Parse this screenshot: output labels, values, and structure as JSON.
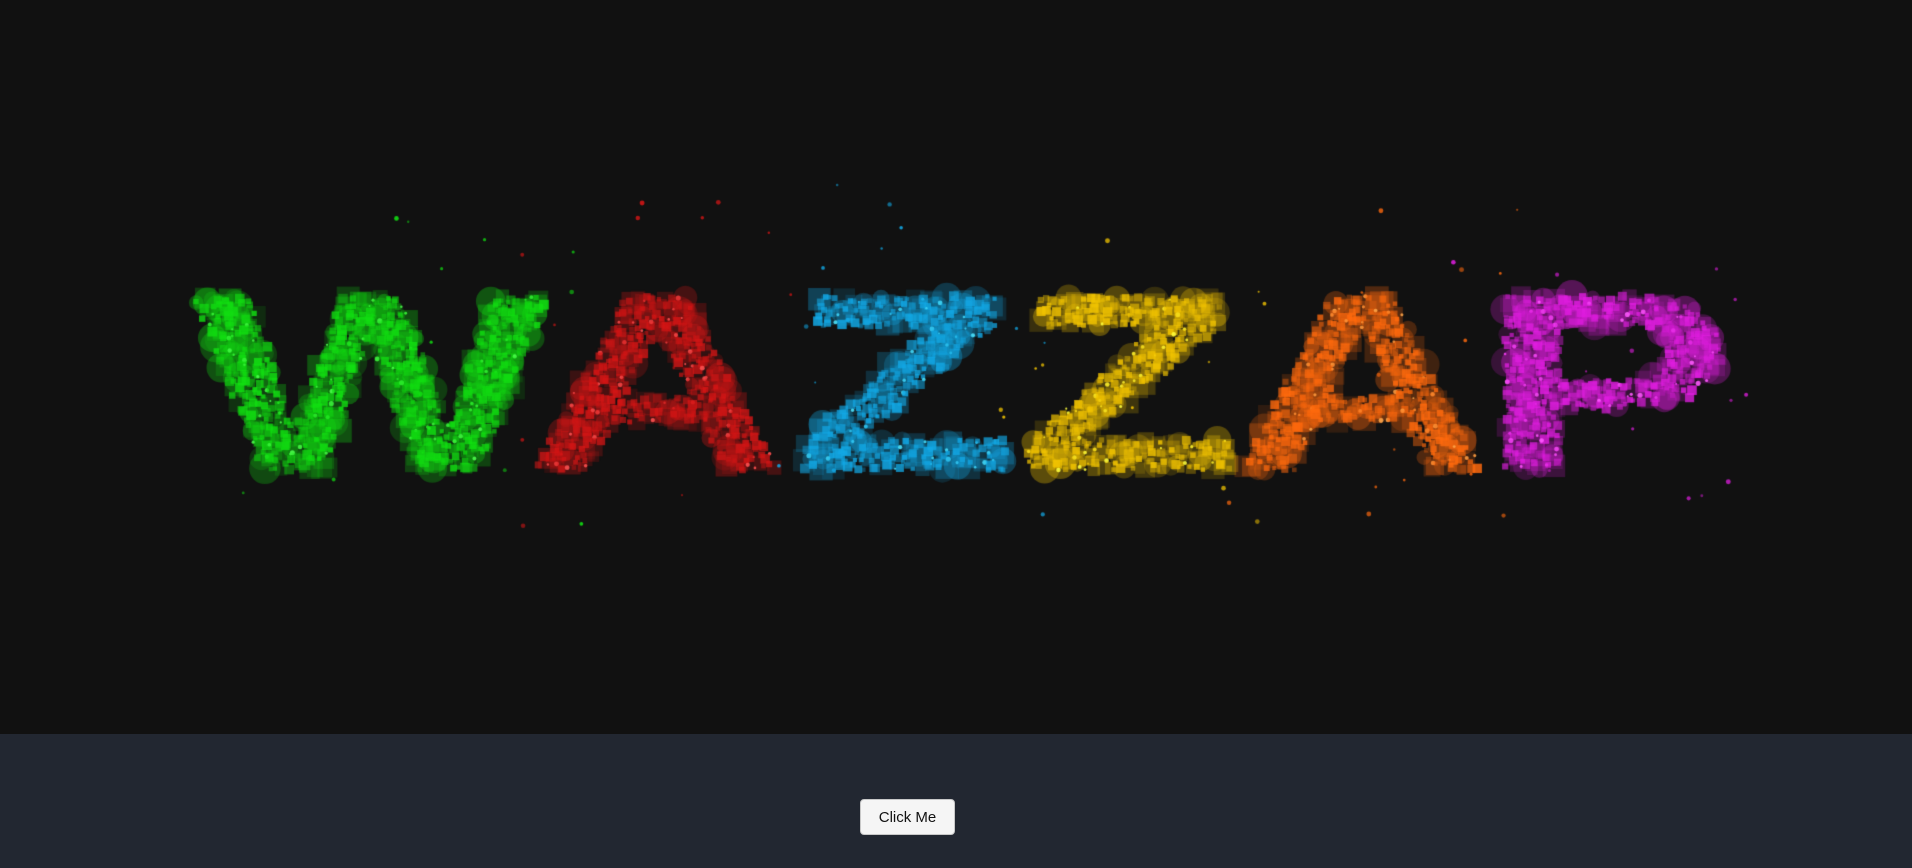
{
  "banner": {
    "letters": [
      {
        "char": "W",
        "color": "#12e012"
      },
      {
        "char": "A",
        "color": "#d41616"
      },
      {
        "char": "Z",
        "color": "#13a9e6"
      },
      {
        "char": "Z",
        "color": "#f2c400"
      },
      {
        "char": "A",
        "color": "#ff6a0e"
      },
      {
        "char": "P",
        "color": "#e01ee0"
      }
    ],
    "background_color": "#111111"
  },
  "footer": {
    "background_color": "#222731",
    "button_label": "Click Me"
  }
}
